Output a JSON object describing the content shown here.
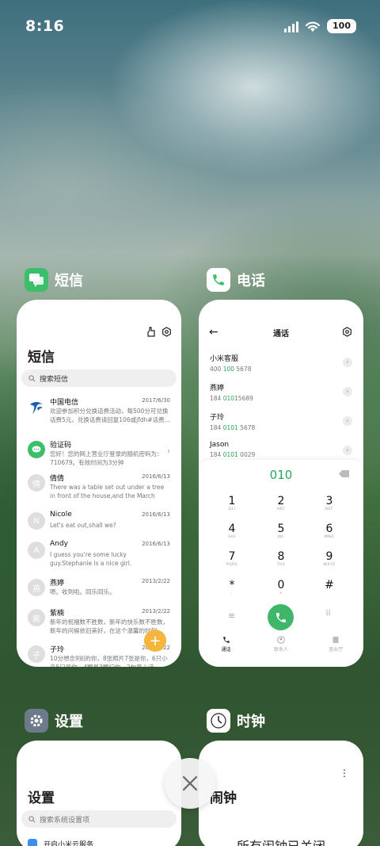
{
  "status_bar": {
    "time": "8:16",
    "battery": "100"
  },
  "apps": {
    "sms": {
      "label": "短信",
      "title": "短信",
      "search_placeholder": "搜索短信",
      "messages": [
        {
          "name": "中国电信",
          "date": "2017/6/30",
          "snippet": "欢迎参加积分兑换话费活动，每500分可兑换话费5元，兑换话费请回复106或jfdh#话费..."
        },
        {
          "name": "验证码",
          "date": "",
          "snippet": "您好！您的网上营业厅登录的随机密码为：710679。有效时间为3分钟"
        },
        {
          "name": "倩倩",
          "date": "2016/6/13",
          "snippet": "There was a table set out under a tree in front of the house,and the March Hare an..."
        },
        {
          "name": "Nicole",
          "date": "2016/6/13",
          "snippet": "Let's eat out,shall we?"
        },
        {
          "name": "Andy",
          "date": "2016/6/13",
          "snippet": "I guess you're some lucky guy.Stephanie is a nice girl."
        },
        {
          "name": "燕婷",
          "date": "2013/2/22",
          "snippet": "嗯。收到啦。同乐同乐。"
        },
        {
          "name": "紫楠",
          "date": "2013/2/22",
          "snippet": "新年的祝福数不胜数，新年的快乐数不胜数，新年的问候依旧美好，在这个温馨的时刻..."
        },
        {
          "name": "子玲",
          "date": "2013/2/22",
          "snippet": "10分想念9别的你，8张照片7张是你，6只小鸟5只是你，4颗星3颗归你，2句真心话..."
        }
      ],
      "avatar_letters": [
        "倩",
        "N",
        "A",
        "燕",
        "紫",
        "子"
      ]
    },
    "phone": {
      "label": "电话",
      "title": "通话",
      "contacts": [
        {
          "name": "小米客服",
          "num_a": "400 ",
          "num_b": "100",
          "num_c": " 5678"
        },
        {
          "name": "燕婷",
          "num_a": "184 ",
          "num_b": "010",
          "num_c": "15689"
        },
        {
          "name": "子玲",
          "num_a": "184 ",
          "num_b": "0101",
          "num_c": " 5678"
        },
        {
          "name": "Jason",
          "num_a": "184 ",
          "num_b": "0101",
          "num_c": " 0029"
        }
      ],
      "dialed": "010",
      "keys": [
        {
          "d": "1",
          "l": "GLI"
        },
        {
          "d": "2",
          "l": "ABC"
        },
        {
          "d": "3",
          "l": "DEF"
        },
        {
          "d": "4",
          "l": "GHI"
        },
        {
          "d": "5",
          "l": "JKL"
        },
        {
          "d": "6",
          "l": "MNO"
        },
        {
          "d": "7",
          "l": "PQRS"
        },
        {
          "d": "8",
          "l": "TUV"
        },
        {
          "d": "9",
          "l": "WXYZ"
        },
        {
          "d": "*",
          "l": ","
        },
        {
          "d": "0",
          "l": "+"
        },
        {
          "d": "#",
          "l": ""
        }
      ],
      "tabs": [
        "通话",
        "联系人",
        "营业厅"
      ]
    },
    "settings": {
      "label": "设置",
      "title": "设置",
      "search_placeholder": "搜索系统设置项",
      "first_item": "开启小米云服务"
    },
    "clock": {
      "label": "时钟",
      "title": "闹钟",
      "message": "所有闹钟已关闭"
    }
  },
  "colors": {
    "accent_green": "#2aa55a",
    "fab_orange": "#f6b53c"
  }
}
